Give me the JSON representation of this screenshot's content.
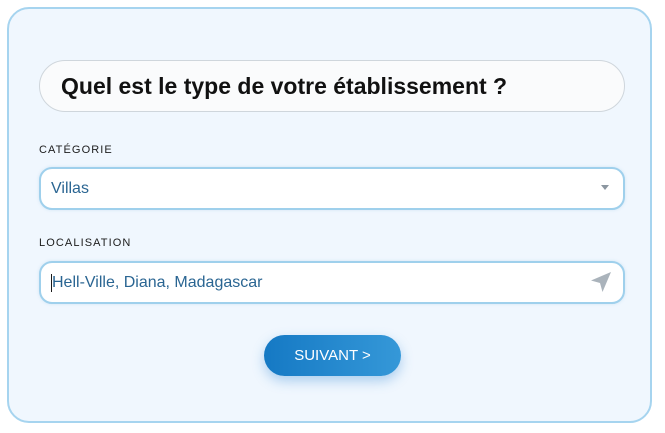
{
  "form": {
    "title": "Quel est le type de votre établissement ?",
    "category": {
      "label": "CATÉGORIE",
      "selected": "Villas"
    },
    "location": {
      "label": "LOCALISATION",
      "value": "Hell-Ville, Diana, Madagascar"
    },
    "next_button": "SUIVANT >"
  },
  "icons": {
    "select": "chevron-down-icon",
    "location": "navigation-arrow-icon"
  },
  "colors": {
    "accent": "#1579c4",
    "field_border": "#9fd0ec",
    "card_background": "#f0f7fe",
    "value_text": "#2a6592"
  }
}
